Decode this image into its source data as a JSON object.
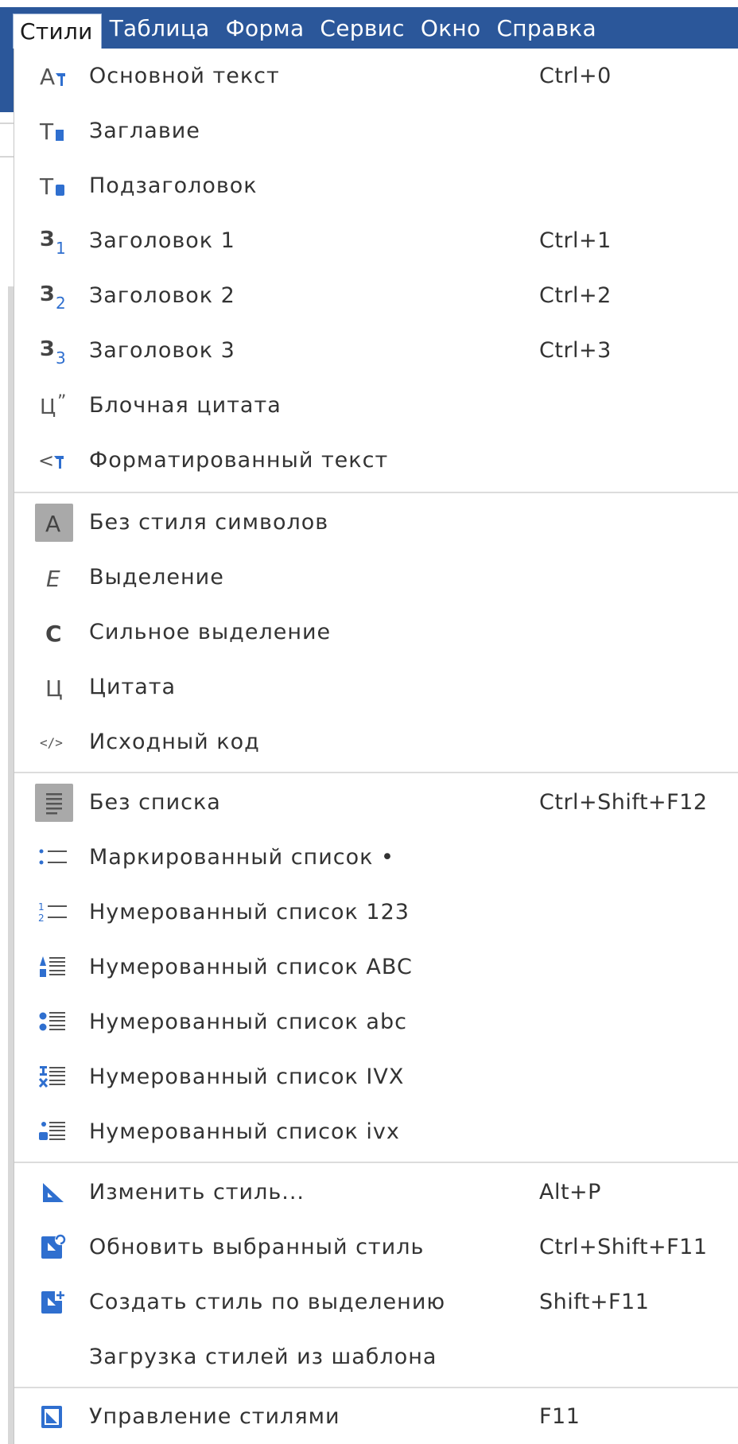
{
  "menubar": {
    "items": [
      {
        "label": "Стили",
        "active": true
      },
      {
        "label": "Таблица"
      },
      {
        "label": "Форма"
      },
      {
        "label": "Сервис"
      },
      {
        "label": "Окно"
      },
      {
        "label": "Справка"
      }
    ]
  },
  "menu": {
    "paragraph_styles": [
      {
        "label": "Основной текст",
        "shortcut": "Ctrl+0",
        "icon": "body-text-icon"
      },
      {
        "label": "Заглавие",
        "shortcut": "",
        "icon": "title-icon"
      },
      {
        "label": "Подзаголовок",
        "shortcut": "",
        "icon": "subtitle-icon"
      },
      {
        "label": "Заголовок 1",
        "shortcut": "Ctrl+1",
        "icon": "heading-1-icon"
      },
      {
        "label": "Заголовок 2",
        "shortcut": "Ctrl+2",
        "icon": "heading-2-icon"
      },
      {
        "label": "Заголовок 3",
        "shortcut": "Ctrl+3",
        "icon": "heading-3-icon"
      },
      {
        "label": "Блочная цитата",
        "shortcut": "",
        "icon": "block-quote-icon"
      },
      {
        "label": "Форматированный текст",
        "shortcut": "",
        "icon": "preformatted-text-icon"
      }
    ],
    "character_styles": [
      {
        "label": "Без стиля символов",
        "shortcut": "",
        "icon": "no-character-style-icon"
      },
      {
        "label": "Выделение",
        "shortcut": "",
        "icon": "emphasis-icon"
      },
      {
        "label": "Сильное выделение",
        "shortcut": "",
        "icon": "strong-emphasis-icon"
      },
      {
        "label": "Цитата",
        "shortcut": "",
        "icon": "quote-icon"
      },
      {
        "label": "Исходный код",
        "shortcut": "",
        "icon": "source-code-icon"
      }
    ],
    "list_styles": [
      {
        "label": "Без списка",
        "shortcut": "Ctrl+Shift+F12",
        "icon": "no-list-icon"
      },
      {
        "label": "Маркированный список •",
        "shortcut": "",
        "icon": "bullet-list-icon"
      },
      {
        "label": "Нумерованный список 123",
        "shortcut": "",
        "icon": "numbered-list-123-icon"
      },
      {
        "label": "Нумерованный список ABC",
        "shortcut": "",
        "icon": "numbered-list-abc-upper-icon"
      },
      {
        "label": "Нумерованный список abc",
        "shortcut": "",
        "icon": "numbered-list-abc-lower-icon"
      },
      {
        "label": "Нумерованный список IVX",
        "shortcut": "",
        "icon": "numbered-list-ivx-upper-icon"
      },
      {
        "label": "Нумерованный список ivx",
        "shortcut": "",
        "icon": "numbered-list-ivx-lower-icon"
      }
    ],
    "style_actions": [
      {
        "label": "Изменить стиль...",
        "shortcut": "Alt+P",
        "icon": "edit-style-icon"
      },
      {
        "label": "Обновить выбранный стиль",
        "shortcut": "Ctrl+Shift+F11",
        "icon": "update-style-icon"
      },
      {
        "label": "Создать стиль по выделению",
        "shortcut": "Shift+F11",
        "icon": "new-style-icon"
      },
      {
        "label": "Загрузка стилей из шаблона",
        "shortcut": "",
        "icon": ""
      }
    ],
    "manage": [
      {
        "label": "Управление стилями",
        "shortcut": "F11",
        "icon": "manage-styles-icon"
      }
    ]
  },
  "colors": {
    "menubar_bg": "#2b579a",
    "icon_blue": "#2f6fcf",
    "text": "#333333",
    "separator": "#dcdcdc"
  }
}
